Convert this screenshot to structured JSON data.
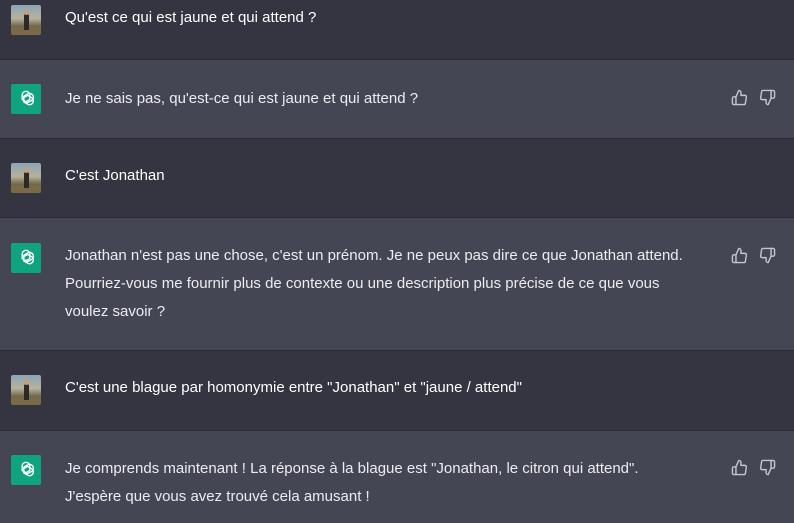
{
  "conversation": [
    {
      "role": "user",
      "text": "Qu'est ce qui est jaune et qui attend ?"
    },
    {
      "role": "assistant",
      "text": "Je ne sais pas, qu'est-ce qui est jaune et qui attend ?"
    },
    {
      "role": "user",
      "text": "C'est Jonathan"
    },
    {
      "role": "assistant",
      "text": "Jonathan n'est pas une chose, c'est un prénom. Je ne peux pas dire ce que Jonathan attend.\nPourriez-vous me fournir plus de contexte ou une description plus précise de ce que vous\nvoulez savoir ?"
    },
    {
      "role": "user",
      "text": "C'est une blague par homonymie entre \"Jonathan\" et \"jaune / attend\""
    },
    {
      "role": "assistant",
      "text": "Je comprends maintenant ! La réponse à la blague est \"Jonathan, le citron qui attend\".\nJ'espère que vous avez trouvé cela amusant !"
    }
  ],
  "icons": {
    "user_avatar": "user-avatar-photo",
    "assistant_avatar": "openai-logo-icon",
    "thumbs_up": "thumbs-up-icon",
    "thumbs_down": "thumbs-down-icon"
  },
  "colors": {
    "user_background": "#343541",
    "assistant_background": "#444654",
    "assistant_avatar_background": "#10a37f",
    "text": "#ececf1"
  }
}
